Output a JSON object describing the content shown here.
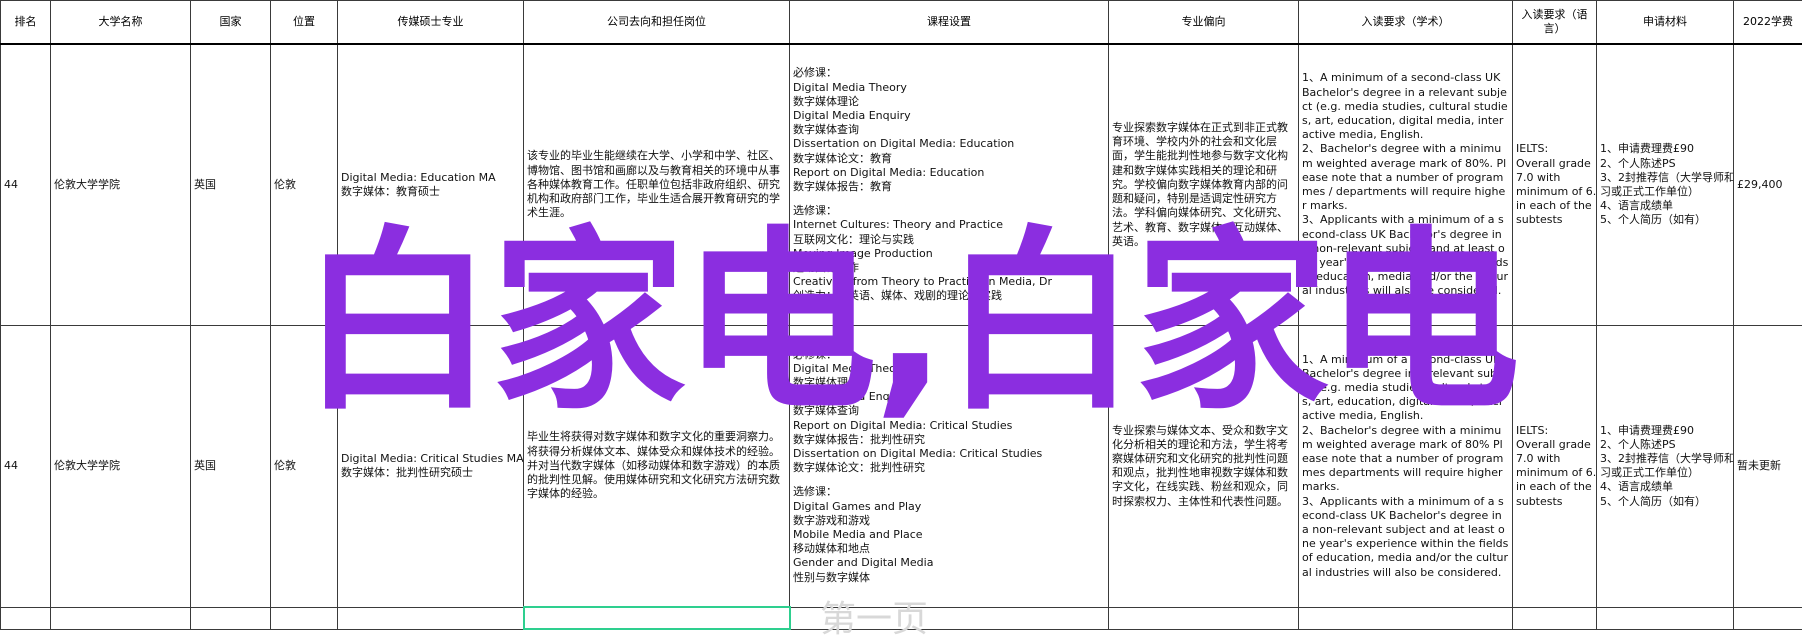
{
  "headers": [
    "排名",
    "大学名称",
    "国家",
    "位置",
    "传媒硕士专业",
    "公司去向和担任岗位",
    "课程设置",
    "专业偏向",
    "入读要求（学术）",
    "入读要求（语言）",
    "申请材料",
    "2022学费"
  ],
  "rows": [
    {
      "rank": "44",
      "university": "伦敦大学学院",
      "country": "英国",
      "location": "伦敦",
      "major": [
        "Digital Media: Education MA",
        "数字媒体：教育硕士"
      ],
      "career": "该专业的毕业生能继续在大学、小学和中学、社区、博物馆、图书馆和画廊以及与教育相关的环境中从事各种媒体教育工作。任职单位包括非政府组织、研究机构和政府部门工作，毕业生适合展开教育研究的学术生涯。",
      "courses": {
        "required_label": "必修课：",
        "required": [
          "Digital Media Theory",
          "数字媒体理论",
          "Digital Media Enquiry",
          "数字媒体查询",
          "Dissertation on Digital Media: Education",
          "数字媒体论文：教育",
          "Report on Digital Media: Education",
          "数字媒体报告：教育"
        ],
        "elective_label": "选修课：",
        "elective": [
          "Internet Cultures: Theory and Practice",
          "互联网文化：理论与实践",
          "Moving Image Production",
          "运动图像制作",
          "Creativity: from Theory to Practice in Media, Dr",
          "创造力：从英语、媒体、戏剧的理论到实践"
        ]
      },
      "focus": "专业探索数字媒体在正式到非正式教育环境、学校内外的社会和文化层面，学生能批判性地参与数字文化构建和数字媒体实践相关的理论和研究。学校偏向数字媒体教育内部的问题和疑问，特别是适调定性研究方法。学科偏向媒体研究、文化研究、艺术、教育、数字媒体、互动媒体、英语。",
      "academic": [
        "1、A minimum of a second-class UK Bachelor's degree in a relevant subject (e.g. media studies, cultural studies, art, education, digital media, interactive media, English.",
        "2、Bachelor's degree with a minimum weighted average mark of 80%. Please note that a number of programmes / departments will require higher marks.",
        "3、Applicants with a minimum of a second-class UK Bachelor's degree in a non-relevant subject and at least one year's experience within the fields of education, media and/or the cultural industries will also be considered."
      ],
      "language": [
        "IELTS:",
        "Overall grade",
        "7.0 with",
        "minimum of 6.5",
        "in each of the",
        "subtests"
      ],
      "materials": [
        "1、申请费理费£90",
        "2、个人陈述PS",
        "3、2封推荐信（大学导师和实",
        "习或正式工作单位）",
        "4、语言成绩单",
        "5、个人简历（如有）"
      ],
      "tuition": "£29,400"
    },
    {
      "rank": "44",
      "university": "伦敦大学学院",
      "country": "英国",
      "location": "伦敦",
      "major": [
        "Digital Media: Critical Studies MA",
        "数字媒体：批判性研究硕士"
      ],
      "career": "毕业生将获得对数字媒体和数字文化的重要洞察力。将获得分析媒体文本、媒体受众和媒体技术的经验。并对当代数字媒体（如移动媒体和数字游戏）的本质的批判性见解。使用媒体研究和文化研究方法研究数字媒体的经验。",
      "courses": {
        "required_label": "必修课：",
        "required": [
          "Digital Media Theory",
          "数字媒体理论",
          "Digital Media Enquiry",
          "数字媒体查询",
          "Report on Digital Media: Critical Studies",
          "数字媒体报告：批判性研究",
          "Dissertation on Digital Media: Critical Studies",
          "数字媒体论文：批判性研究"
        ],
        "elective_label": "选修课：",
        "elective": [
          "Digital Games and Play",
          "数字游戏和游戏",
          "Mobile Media and Place",
          "移动媒体和地点",
          "Gender and Digital Media",
          "性别与数字媒体"
        ]
      },
      "focus": "专业探索与媒体文本、受众和数字文化分析相关的理论和方法，学生将考察媒体研究和文化研究的批判性问题和观点，批判性地审视数字媒体和数字文化，在线实践、粉丝和观众，同时探索权力、主体性和代表性问题。",
      "academic": [
        "1、A minimum of a second-class UK Bachelor's degree in a relevant subject (e.g. media studies, cultural studies, art, education, digital media, interactive media, English.",
        "2、Bachelor's degree with a minimum weighted average mark of 80% Please note that a number of programmes departments will require higher marks.",
        "3、Applicants with a minimum of a second-class UK Bachelor's degree in a non-relevant subject and at least one year's experience within the fields of education, media and/or the cultural industries will also be considered."
      ],
      "language": [
        "IELTS:",
        "Overall grade",
        "7.0 with",
        "minimum of 6.5",
        "in each of the",
        "subtests"
      ],
      "materials": [
        "1、申请费理费£90",
        "2、个人陈述PS",
        "3、2封推荐信（大学导师和实",
        "习或正式工作单位）",
        "4、语言成绩单",
        "5、个人简历（如有）"
      ],
      "tuition": "暂未更新"
    }
  ],
  "overlay": {
    "watermark": "白家电,白家电",
    "faint_text": "第一页"
  },
  "colors": {
    "watermark": "#8b2ee0",
    "selection_border": "#2ecf8f"
  }
}
